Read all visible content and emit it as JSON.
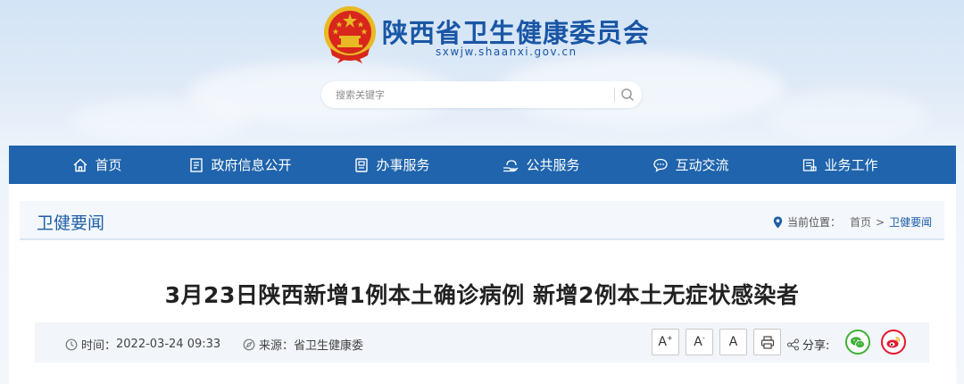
{
  "header": {
    "site_title": "陕西省卫生健康委员会",
    "site_domain": "sxwjw.shaanxi.gov.cn",
    "logo_icon": "national-emblem-icon"
  },
  "search": {
    "placeholder": "搜索关键字",
    "button_icon": "search-icon"
  },
  "nav": {
    "items": [
      {
        "label": "首页",
        "icon": "home-icon"
      },
      {
        "label": "政府信息公开",
        "icon": "document-list-icon"
      },
      {
        "label": "办事服务",
        "icon": "form-icon"
      },
      {
        "label": "公共服务",
        "icon": "hand-service-icon"
      },
      {
        "label": "互动交流",
        "icon": "chat-bubble-icon"
      },
      {
        "label": "业务工作",
        "icon": "briefcase-icon"
      }
    ]
  },
  "section": {
    "title": "卫健要闻",
    "breadcrumb_label": "当前位置：",
    "breadcrumb_home": "首页",
    "breadcrumb_sep": ">",
    "breadcrumb_current": "卫健要闻"
  },
  "article": {
    "title": "3月23日陕西新增1例本土确诊病例 新增2例本土无症状感染者",
    "time_label": "时间：",
    "time_value": "2022-03-24 09:33",
    "source_label": "来源：",
    "source_value": "省卫生健康委",
    "font_large": "A",
    "font_large_sup": "+",
    "font_small": "A",
    "font_small_sup": "-",
    "font_reset": "A",
    "print_icon": "printer-icon",
    "share_label": "分享:",
    "share_wechat_icon": "wechat-icon",
    "share_weibo_icon": "weibo-icon"
  },
  "colors": {
    "nav_bg": "#1f64ac",
    "brand_blue": "#1a56a5",
    "emblem_red": "#d8261c",
    "emblem_gold": "#e8b923",
    "wechat_green": "#3eb135",
    "weibo_red": "#e6162d"
  }
}
